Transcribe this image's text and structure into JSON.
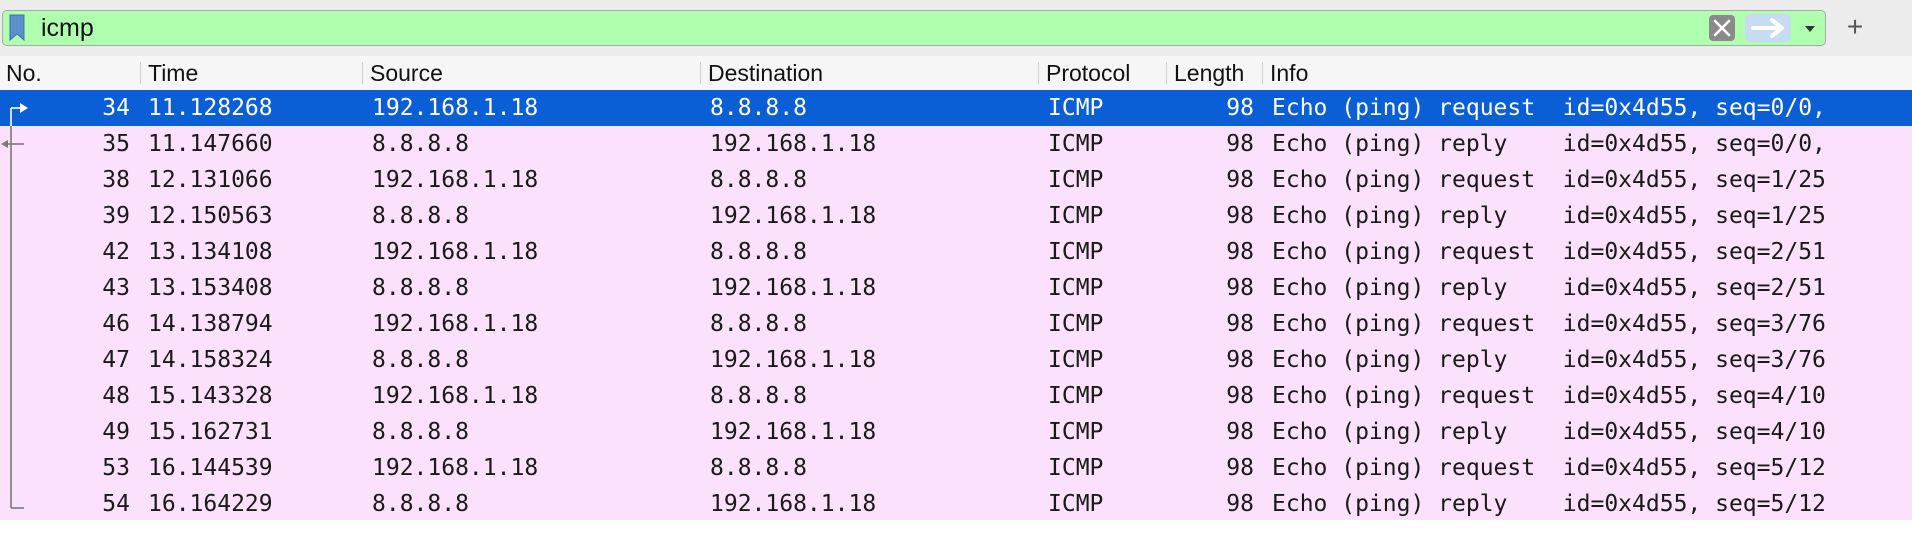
{
  "filter": {
    "value": "icmp",
    "bookmark_icon": "bookmark-icon",
    "clear_icon": "clear-x-icon",
    "apply_icon": "arrow-right-icon",
    "dropdown_icon": "chevron-down-icon",
    "add_label": "+"
  },
  "columns": {
    "no": "No.",
    "time": "Time",
    "source": "Source",
    "destination": "Destination",
    "protocol": "Protocol",
    "length": "Length",
    "info": "Info"
  },
  "colors": {
    "filter_valid": "#afffaf",
    "row_icmp": "#fbe1fb",
    "row_selected": "#0a5fd6"
  },
  "selected_no": "34",
  "packets": [
    {
      "no": "34",
      "time": "11.128268",
      "source": "192.168.1.18",
      "destination": "8.8.8.8",
      "protocol": "ICMP",
      "length": "98",
      "info": "Echo (ping) request  id=0x4d55, seq=0/0,",
      "related": "request-start"
    },
    {
      "no": "35",
      "time": "11.147660",
      "source": "8.8.8.8",
      "destination": "192.168.1.18",
      "protocol": "ICMP",
      "length": "98",
      "info": "Echo (ping) reply    id=0x4d55, seq=0/0,",
      "related": "reply"
    },
    {
      "no": "38",
      "time": "12.131066",
      "source": "192.168.1.18",
      "destination": "8.8.8.8",
      "protocol": "ICMP",
      "length": "98",
      "info": "Echo (ping) request  id=0x4d55, seq=1/25",
      "related": "line"
    },
    {
      "no": "39",
      "time": "12.150563",
      "source": "8.8.8.8",
      "destination": "192.168.1.18",
      "protocol": "ICMP",
      "length": "98",
      "info": "Echo (ping) reply    id=0x4d55, seq=1/25",
      "related": "line"
    },
    {
      "no": "42",
      "time": "13.134108",
      "source": "192.168.1.18",
      "destination": "8.8.8.8",
      "protocol": "ICMP",
      "length": "98",
      "info": "Echo (ping) request  id=0x4d55, seq=2/51",
      "related": "line"
    },
    {
      "no": "43",
      "time": "13.153408",
      "source": "8.8.8.8",
      "destination": "192.168.1.18",
      "protocol": "ICMP",
      "length": "98",
      "info": "Echo (ping) reply    id=0x4d55, seq=2/51",
      "related": "line"
    },
    {
      "no": "46",
      "time": "14.138794",
      "source": "192.168.1.18",
      "destination": "8.8.8.8",
      "protocol": "ICMP",
      "length": "98",
      "info": "Echo (ping) request  id=0x4d55, seq=3/76",
      "related": "line"
    },
    {
      "no": "47",
      "time": "14.158324",
      "source": "8.8.8.8",
      "destination": "192.168.1.18",
      "protocol": "ICMP",
      "length": "98",
      "info": "Echo (ping) reply    id=0x4d55, seq=3/76",
      "related": "line"
    },
    {
      "no": "48",
      "time": "15.143328",
      "source": "192.168.1.18",
      "destination": "8.8.8.8",
      "protocol": "ICMP",
      "length": "98",
      "info": "Echo (ping) request  id=0x4d55, seq=4/10",
      "related": "line"
    },
    {
      "no": "49",
      "time": "15.162731",
      "source": "8.8.8.8",
      "destination": "192.168.1.18",
      "protocol": "ICMP",
      "length": "98",
      "info": "Echo (ping) reply    id=0x4d55, seq=4/10",
      "related": "line"
    },
    {
      "no": "53",
      "time": "16.144539",
      "source": "192.168.1.18",
      "destination": "8.8.8.8",
      "protocol": "ICMP",
      "length": "98",
      "info": "Echo (ping) request  id=0x4d55, seq=5/12",
      "related": "line"
    },
    {
      "no": "54",
      "time": "16.164229",
      "source": "8.8.8.8",
      "destination": "192.168.1.18",
      "protocol": "ICMP",
      "length": "98",
      "info": "Echo (ping) reply    id=0x4d55, seq=5/12",
      "related": "end"
    }
  ]
}
